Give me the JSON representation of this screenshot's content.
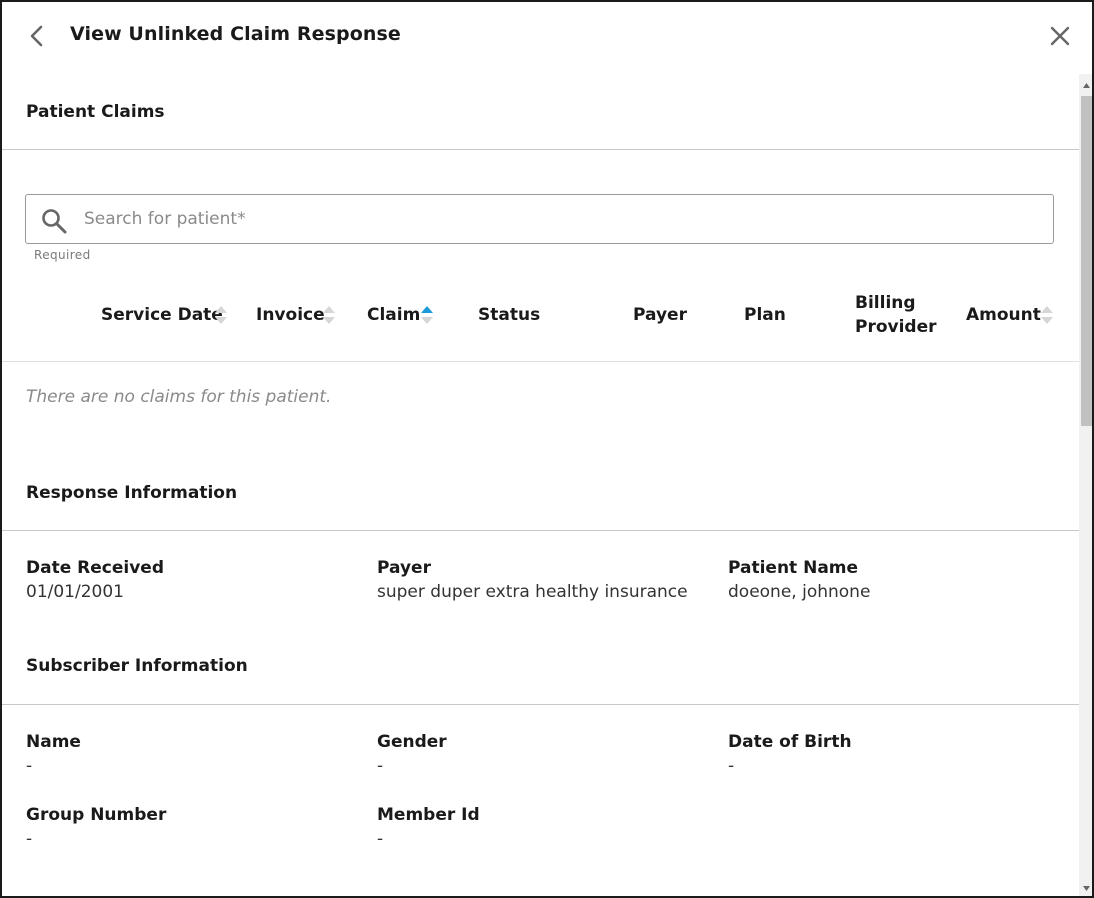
{
  "header": {
    "title": "View Unlinked Claim Response",
    "back_icon": "chevron-left-icon",
    "close_icon": "close-icon"
  },
  "patient_claims": {
    "section_title": "Patient Claims",
    "search": {
      "value": "",
      "placeholder": "Search for patient*",
      "hint": "Required",
      "icon": "search-icon"
    },
    "columns": [
      {
        "label": "Service Date",
        "sortable": true,
        "sort": "none"
      },
      {
        "label": "Invoice",
        "sortable": true,
        "sort": "none"
      },
      {
        "label": "Claim",
        "sortable": true,
        "sort": "ascending"
      },
      {
        "label": "Status",
        "sortable": false
      },
      {
        "label": "Payer",
        "sortable": false
      },
      {
        "label": "Plan",
        "sortable": false
      },
      {
        "label": "Billing Provider",
        "line1": "Billing",
        "line2": "Provider",
        "sortable": false
      },
      {
        "label": "Amount",
        "sortable": true,
        "sort": "none"
      }
    ],
    "empty_message": "There are no claims for this patient."
  },
  "response_information": {
    "section_title": "Response Information",
    "fields": [
      {
        "label": "Date Received",
        "value": "01/01/2001"
      },
      {
        "label": "Payer",
        "value": "super duper extra healthy insurance"
      },
      {
        "label": "Patient Name",
        "value": "doeone, johnone"
      }
    ]
  },
  "subscriber_information": {
    "section_title": "Subscriber Information",
    "fields": [
      {
        "label": "Name",
        "value": "-"
      },
      {
        "label": "Gender",
        "value": "-"
      },
      {
        "label": "Date of Birth",
        "value": "-"
      },
      {
        "label": "Group Number",
        "value": "-"
      },
      {
        "label": "Member Id",
        "value": "-"
      }
    ]
  },
  "colors": {
    "sort_active": "#1a9bd7",
    "sort_inactive": "#d6d6d6",
    "divider": "#c8c8c8",
    "muted_text": "#8a8a8a"
  }
}
